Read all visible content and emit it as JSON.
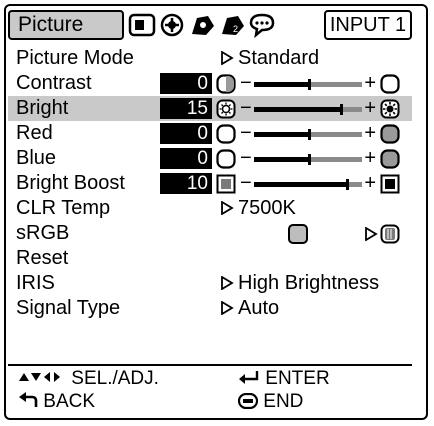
{
  "header": {
    "active_tab": "Picture",
    "tabs_icons": [
      "picture-tab-icon",
      "fine-sync-tab-icon",
      "options1-tab-icon",
      "options2-tab-icon",
      "language-tab-icon"
    ],
    "input": "INPUT 1"
  },
  "menu": {
    "picture_mode": {
      "label": "Picture Mode",
      "value": "Standard"
    },
    "contrast": {
      "label": "Contrast",
      "value": "0",
      "level": 0.5
    },
    "bright": {
      "label": "Bright",
      "value": "15",
      "level": 0.8
    },
    "red": {
      "label": "Red",
      "value": "0",
      "level": 0.5
    },
    "blue": {
      "label": "Blue",
      "value": "0",
      "level": 0.5
    },
    "bright_boost": {
      "label": "Bright Boost",
      "value": "10",
      "level": 0.85
    },
    "clr_temp": {
      "label": "CLR Temp",
      "value": "7500K"
    },
    "srgb": {
      "label": "sRGB"
    },
    "reset": {
      "label": "Reset"
    },
    "iris": {
      "label": "IRIS",
      "value": "High Brightness"
    },
    "signal_type": {
      "label": "Signal Type",
      "value": "Auto"
    },
    "selected_item": "Bright"
  },
  "footer": {
    "sel_adj": "SEL./ADJ.",
    "enter": "ENTER",
    "back": "BACK",
    "end": "END"
  }
}
